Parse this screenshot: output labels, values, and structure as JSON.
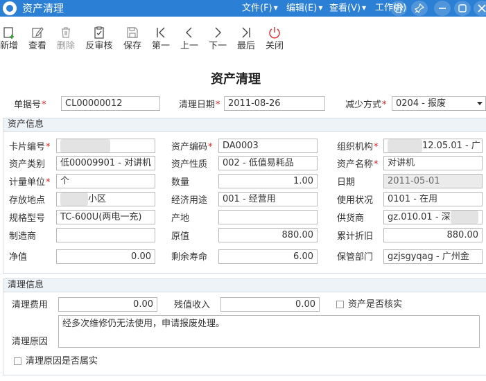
{
  "titlebar": {
    "title": "资产清理",
    "menus": [
      "文件(F)",
      "编辑(E)",
      "查看(V)",
      "工作(R)"
    ],
    "colors": {
      "accent": "#2b7fd4"
    }
  },
  "toolbar": {
    "new": "新增",
    "view": "查看",
    "delete": "删除",
    "unaudit": "反审核",
    "save": "保存",
    "first": "第一",
    "prev": "上一",
    "next": "下一",
    "last": "最后",
    "close": "关闭"
  },
  "form": {
    "title": "资产清理",
    "doc_no_label": "单据号",
    "doc_no": "CL00000012",
    "clear_date_label": "清理日期",
    "clear_date": "2011-08-26",
    "reduce_mode_label": "减少方式",
    "reduce_mode": "0204 - 报废"
  },
  "asset_info": {
    "title": "资产信息",
    "card_no_label": "卡片编号",
    "card_no": "",
    "asset_code_label": "资产编码",
    "asset_code": "DA0003",
    "org_label": "组织机构",
    "org": "12.05.01  - 广",
    "category_label": "资产类别",
    "category": "低00009901 - 对讲机",
    "nature_label": "资产性质",
    "nature": "002 - 低值易耗品",
    "asset_name_label": "资产名称",
    "asset_name": "对讲机",
    "unit_label": "计量单位",
    "unit": "个",
    "quantity_label": "数量",
    "quantity": "1.00",
    "date_label": "日期",
    "date": "2011-05-01",
    "location_label": "存放地点",
    "location": "小区",
    "usage_label": "经济用途",
    "usage": "001 - 经营用",
    "status_label": "使用状况",
    "status": "0101 - 在用",
    "model_label": "规格型号",
    "model": "TC-600U(两电一充)",
    "origin_label": "产地",
    "origin": "",
    "supplier_label": "供货商",
    "supplier": "gz.010.01 - 深",
    "manufacturer_label": "制造商",
    "manufacturer": "",
    "original_value_label": "原值",
    "original_value": "880.00",
    "acc_depr_label": "累计折旧",
    "acc_depr": "880.00",
    "net_value_label": "净值",
    "net_value": "0.00",
    "remaining_life_label": "剩余寿命",
    "remaining_life": "6.00",
    "custodian_label": "保管部门",
    "custodian": "gzjsgyqag  - 广州金"
  },
  "clear_info": {
    "title": "清理信息",
    "cost_label": "清理费用",
    "cost": "0.00",
    "residual_label": "残值收入",
    "residual": "0.00",
    "audited_label": "资产是否核实",
    "reason_label": "清理原因",
    "reason": "经多次维修仍无法使用，申请报废处理。",
    "reason_true_label": "清理原因是否属实"
  }
}
